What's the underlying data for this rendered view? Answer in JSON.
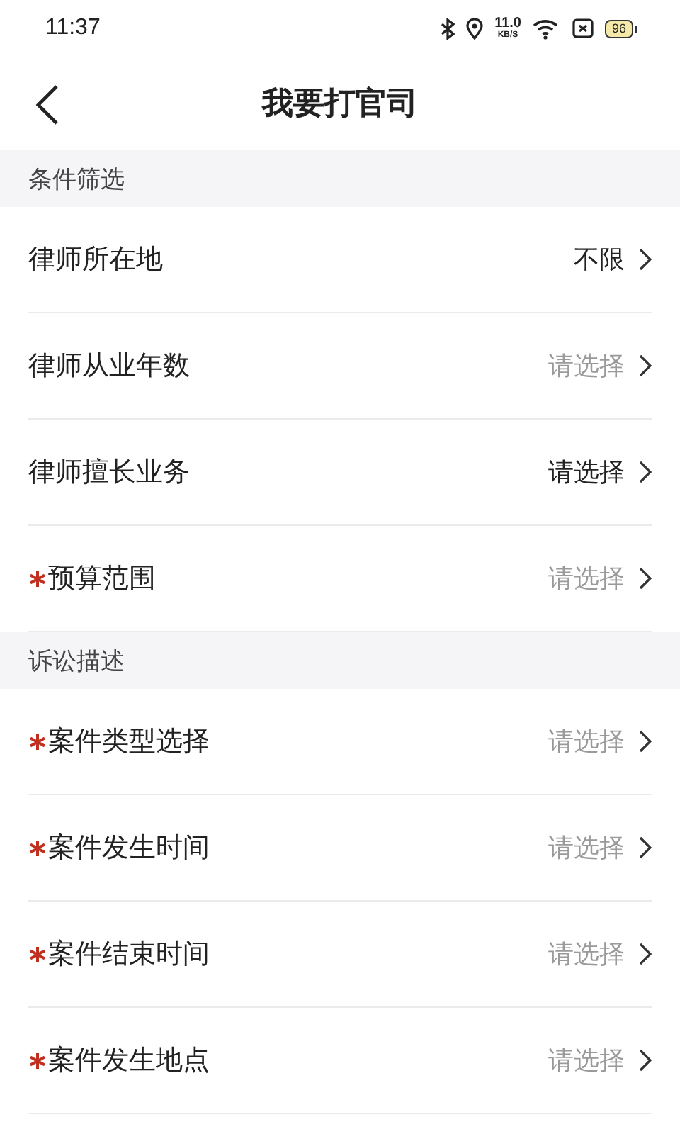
{
  "status_bar": {
    "time": "11:37",
    "net_speed": "11.0",
    "net_unit": "KB/S",
    "battery": "96"
  },
  "header": {
    "title": "我要打官司"
  },
  "sections": [
    {
      "title": "条件筛选",
      "rows": [
        {
          "label": "律师所在地",
          "required": false,
          "value": "不限",
          "set": true
        },
        {
          "label": "律师从业年数",
          "required": false,
          "value": "请选择",
          "set": false
        },
        {
          "label": "律师擅长业务",
          "required": false,
          "value": "请选择",
          "set": true
        },
        {
          "label": "预算范围",
          "required": true,
          "value": "请选择",
          "set": false
        }
      ]
    },
    {
      "title": "诉讼描述",
      "rows": [
        {
          "label": "案件类型选择",
          "required": true,
          "value": "请选择",
          "set": false
        },
        {
          "label": "案件发生时间",
          "required": true,
          "value": "请选择",
          "set": false
        },
        {
          "label": "案件结束时间",
          "required": true,
          "value": "请选择",
          "set": false
        },
        {
          "label": "案件发生地点",
          "required": true,
          "value": "请选择",
          "set": false
        }
      ]
    }
  ]
}
